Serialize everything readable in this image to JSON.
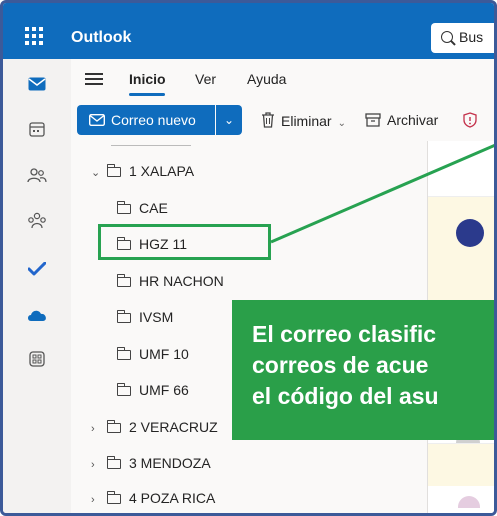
{
  "app": {
    "name": "Outlook"
  },
  "search": {
    "text": "Bus"
  },
  "tabs": [
    {
      "label": "Inicio"
    },
    {
      "label": "Ver"
    },
    {
      "label": "Ayuda"
    }
  ],
  "ribbon": {
    "new_mail": "Correo nuevo",
    "delete": "Eliminar",
    "archive": "Archivar"
  },
  "folders": [
    {
      "label": "1 XALAPA",
      "expanded": true
    },
    {
      "label": "CAE"
    },
    {
      "label": "HGZ 11"
    },
    {
      "label": "HR NACHON"
    },
    {
      "label": "IVSM"
    },
    {
      "label": "UMF 10"
    },
    {
      "label": "UMF 66"
    },
    {
      "label": "2 VERACRUZ",
      "expanded": false
    },
    {
      "label": "3 MENDOZA",
      "expanded": false
    },
    {
      "label": "4 POZA RICA",
      "expanded": false
    }
  ],
  "callout": {
    "line1": "El correo clasific",
    "line2": "correos de acue",
    "line3": "el código del asu"
  },
  "colors": {
    "brand": "#0f6cbd",
    "callout": "#2a9f49",
    "highlight": "#27a251"
  }
}
